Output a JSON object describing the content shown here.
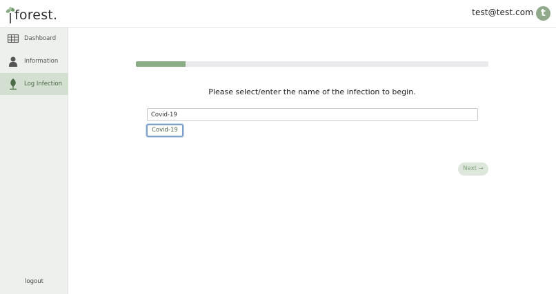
{
  "header": {
    "logo_text": "forest.",
    "user_email": "test@test.com",
    "avatar_letter": "t"
  },
  "sidebar": {
    "items": [
      {
        "label": "Dashboard",
        "icon": "table-grid-icon",
        "active": false
      },
      {
        "label": "Information",
        "icon": "person-icon",
        "active": false
      },
      {
        "label": "Log Infection",
        "icon": "leaf-icon",
        "active": true
      }
    ],
    "logout_label": "logout"
  },
  "main": {
    "progress_fraction": 0.14,
    "prompt": "Please select/enter the name of the infection to begin.",
    "input_value": "Covid-19",
    "suggestions": [
      "Covid-19"
    ],
    "next_label": "Next →"
  },
  "colors": {
    "accent": "#8bad86",
    "sidebar_bg": "#edf0ec",
    "sidebar_active": "#d3dfd0",
    "avatar": "#8fa98a"
  }
}
